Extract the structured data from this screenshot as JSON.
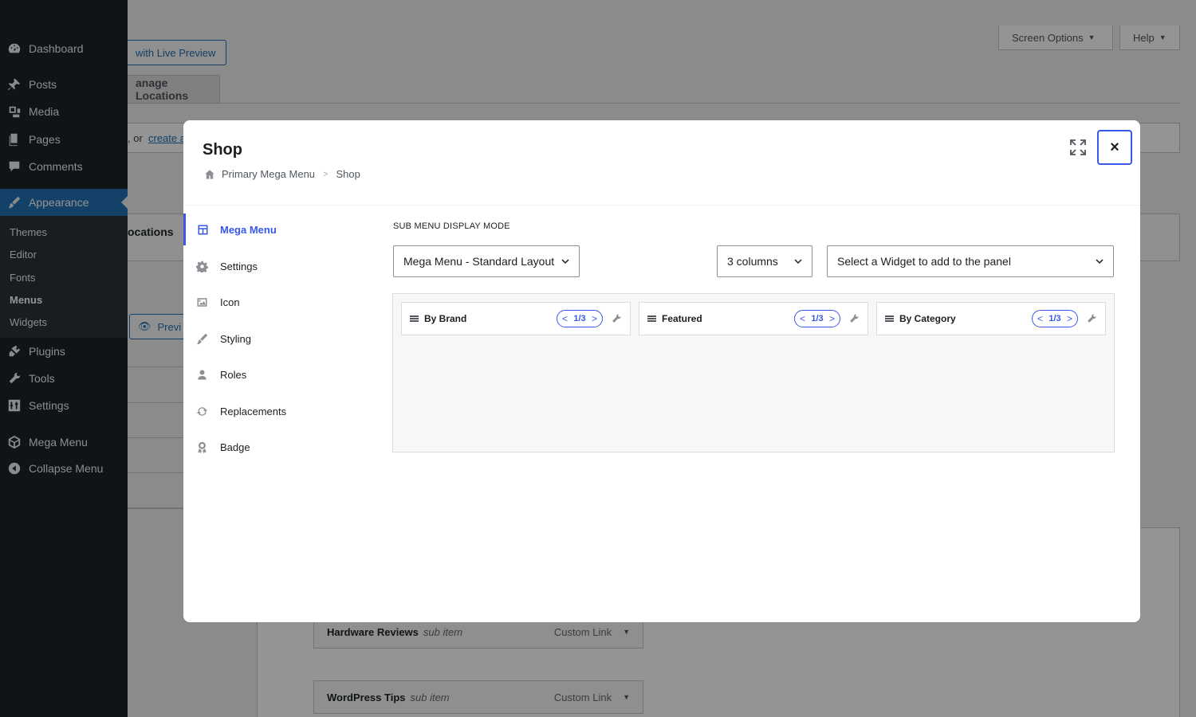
{
  "sidebar": {
    "items": [
      {
        "label": "Dashboard",
        "icon": "dashboard-icon"
      },
      {
        "label": "Posts",
        "icon": "pin-icon"
      },
      {
        "label": "Media",
        "icon": "media-icon"
      },
      {
        "label": "Pages",
        "icon": "pages-icon"
      },
      {
        "label": "Comments",
        "icon": "comment-icon"
      },
      {
        "label": "Appearance",
        "icon": "brush-icon"
      },
      {
        "label": "Plugins",
        "icon": "plugin-icon"
      },
      {
        "label": "Tools",
        "icon": "wrench-icon"
      },
      {
        "label": "Settings",
        "icon": "sliders-icon"
      },
      {
        "label": "Mega Menu",
        "icon": "cube-icon"
      },
      {
        "label": "Collapse Menu",
        "icon": "collapse-icon"
      }
    ],
    "submenu": [
      "Themes",
      "Editor",
      "Fonts",
      "Menus",
      "Widgets"
    ],
    "accent": "#2271b1"
  },
  "background": {
    "live_preview": "with Live Preview",
    "screen_options": "Screen Options",
    "help": "Help",
    "manage_locations": "anage Locations",
    "instructions": ", or",
    "create_link": "create a",
    "locations": "ocations",
    "preview": "Previ",
    "menu_rows": [
      {
        "title": "Hardware Reviews",
        "sub": "sub item",
        "kind": "Custom Link"
      },
      {
        "title": "WordPress Tips",
        "sub": "sub item",
        "kind": "Custom Link"
      }
    ]
  },
  "modal": {
    "title": "Shop",
    "breadcrumb": {
      "root": "Primary Mega Menu",
      "current": "Shop"
    },
    "close": "×",
    "nav": [
      {
        "label": "Mega Menu",
        "icon": "layout-icon"
      },
      {
        "label": "Settings",
        "icon": "gear-icon"
      },
      {
        "label": "Icon",
        "icon": "image-icon"
      },
      {
        "label": "Styling",
        "icon": "brush-icon"
      },
      {
        "label": "Roles",
        "icon": "user-icon"
      },
      {
        "label": "Replacements",
        "icon": "refresh-icon"
      },
      {
        "label": "Badge",
        "icon": "award-icon"
      }
    ],
    "section_label": "SUB MENU DISPLAY MODE",
    "display_mode": "Mega Menu - Standard Layout",
    "columns": "3 columns",
    "widget_select": "Select a Widget to add to the panel",
    "panel_columns": [
      {
        "title": "By Brand",
        "span": "1/3"
      },
      {
        "title": "Featured",
        "span": "1/3"
      },
      {
        "title": "By Category",
        "span": "1/3"
      }
    ],
    "accent": "#3858e9"
  }
}
